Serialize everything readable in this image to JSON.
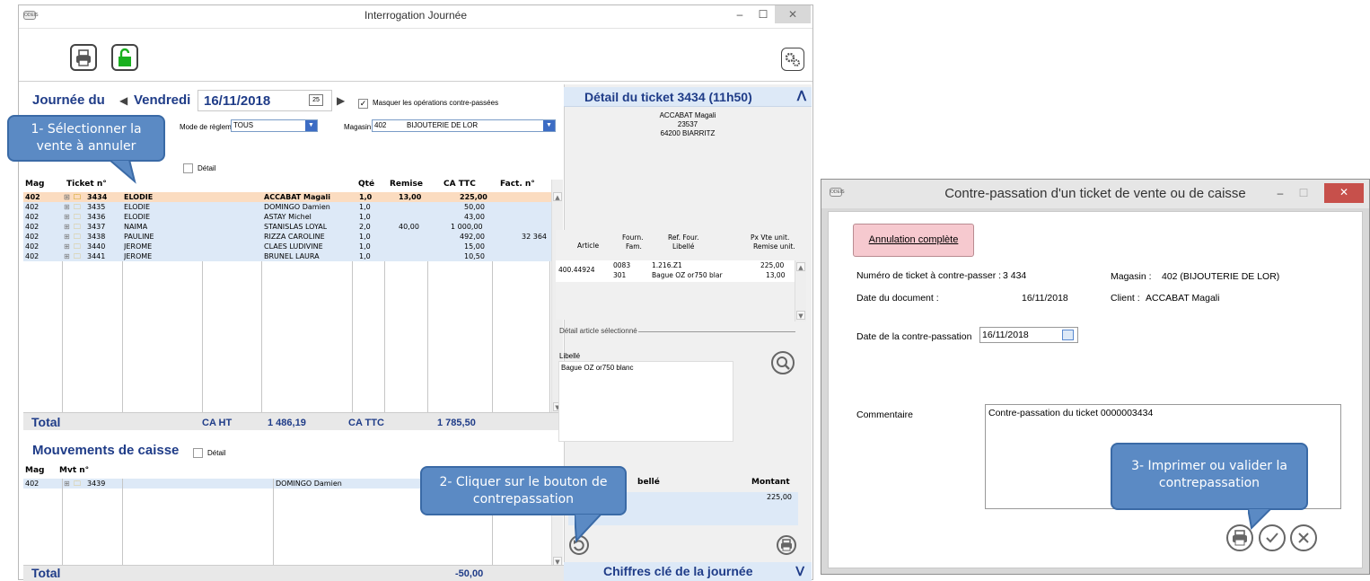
{
  "main": {
    "title": "Interrogation Journée",
    "logo": "ODEIS",
    "min_glyph": "–",
    "max_glyph": "☐",
    "close_glyph": "✕",
    "journee_label": "Journée du",
    "day": "Vendredi",
    "date": "16/11/2018",
    "prev_glyph": "◀",
    "next_glyph": "▶",
    "masquer_label": "Masquer les opérations contre-passées",
    "mode_label": "Mode de règlement",
    "mode_value": "TOUS",
    "magasin_label": "Magasin",
    "magasin_code": "402",
    "magasin_name": "BIJOUTERIE DE LOR",
    "detail_label": "Détail",
    "columns": {
      "mag": "Mag",
      "ticket": "Ticket n°",
      "qte": "Qté",
      "remise": "Remise",
      "cattc": "CA TTC",
      "fact": "Fact. n°"
    },
    "tickets": [
      {
        "mag": "402",
        "ticket": "3434",
        "vendeur": "ELODIE",
        "client": "ACCABAT Magali",
        "qte": "1,0",
        "remise": "13,00",
        "cattc": "225,00",
        "fact": ""
      },
      {
        "mag": "402",
        "ticket": "3435",
        "vendeur": "ELODIE",
        "client": "DOMINGO Damien",
        "qte": "1,0",
        "remise": "",
        "cattc": "50,00",
        "fact": ""
      },
      {
        "mag": "402",
        "ticket": "3436",
        "vendeur": "ELODIE",
        "client": "ASTAY Michel",
        "qte": "1,0",
        "remise": "",
        "cattc": "43,00",
        "fact": ""
      },
      {
        "mag": "402",
        "ticket": "3437",
        "vendeur": "NAIMA",
        "client": "STANISLAS LOYAL",
        "qte": "2,0",
        "remise": "40,00",
        "cattc": "1 000,00",
        "fact": ""
      },
      {
        "mag": "402",
        "ticket": "3438",
        "vendeur": "PAULINE",
        "client": "RIZZA CAROLINE",
        "qte": "1,0",
        "remise": "",
        "cattc": "492,00",
        "fact": "32 364"
      },
      {
        "mag": "402",
        "ticket": "3440",
        "vendeur": "JEROME",
        "client": "CLAES LUDIVINE",
        "qte": "1,0",
        "remise": "",
        "cattc": "15,00",
        "fact": ""
      },
      {
        "mag": "402",
        "ticket": "3441",
        "vendeur": "JEROME",
        "client": "BRUNEL LAURA",
        "qte": "1,0",
        "remise": "",
        "cattc": "10,50",
        "fact": ""
      }
    ],
    "total_label": "Total",
    "caht_label": "CA HT",
    "caht_value": "1 486,19",
    "cattc_label": "CA TTC",
    "cattc_value": "1 785,50",
    "mvt_title": "Mouvements de caisse",
    "mvt_detail_label": "Détail",
    "mvt_columns": {
      "mag": "Mag",
      "mvt": "Mvt n°"
    },
    "mvt_rows": [
      {
        "mag": "402",
        "mvt": "3439",
        "client": "DOMINGO Damien",
        "montant": "225,00"
      }
    ],
    "mvt_total_label": "Total",
    "mvt_total_value": "-50,00",
    "detail_ticket_title": "Détail du ticket 3434 (11h50)",
    "client_name": "ACCABAT Magali",
    "client_num": "23537",
    "client_city": "64200 BIARRITZ",
    "art_cols": {
      "article": "Article",
      "fourn": "Fourn.",
      "fam": "Fam.",
      "ref": "Ref. Four.",
      "libelle": "Libellé",
      "pxvte": "Px Vte unit.",
      "remise_unit": "Remise unit."
    },
    "article": {
      "code": "400.44924",
      "fourn": "0083",
      "fam": "301",
      "ref": "1.216.Z1",
      "libelle": "Bague OZ or750 blar",
      "px": "225,00",
      "remise": "13,00"
    },
    "detail_article_label": "Détail article sélectionné",
    "libelle_label": "Libellé",
    "libelle_value": "Bague OZ or750 blanc",
    "pay_libelle_label": "bellé",
    "pay_montant_label": "Montant",
    "chiffres_label": "Chiffres clé de la journée"
  },
  "dialog": {
    "title": "Contre-passation d'un ticket de vente ou de caisse",
    "logo": "ODEIS",
    "annulation_label": "Annulation complète",
    "num_ticket_label": "Numéro de ticket à contre-passer :",
    "num_ticket_value": "3 434",
    "magasin_label": "Magasin :",
    "magasin_value": "402 (BIJOUTERIE DE LOR)",
    "date_doc_label": "Date du document :",
    "date_doc_value": "16/11/2018",
    "client_label": "Client :",
    "client_value": "ACCABAT Magali",
    "date_cp_label": "Date de la contre-passation",
    "date_cp_value": "16/11/2018",
    "commentaire_label": "Commentaire",
    "commentaire_value": "Contre-passation du ticket 0000003434"
  },
  "callouts": {
    "c1": "1- Sélectionner la vente à annuler",
    "c2": "2- Cliquer sur le bouton de contrepassation",
    "c3": "3- Imprimer ou valider la contrepassation"
  },
  "icons": {
    "print": "printer-icon",
    "lock": "padlock-open-icon",
    "settings": "gears-icon",
    "calendar": "calendar-icon",
    "search": "magnifier-icon",
    "undo": "undo-icon",
    "ok": "checkmark-icon",
    "cancel": "cross-icon"
  },
  "colors": {
    "accent": "#1f3c88",
    "selected_row": "#fbdcc0",
    "row_bg": "#dde9f7",
    "callout": "#5b8ac4",
    "annul_btn": "#f6c9cf",
    "close_btn": "#c7504b"
  }
}
